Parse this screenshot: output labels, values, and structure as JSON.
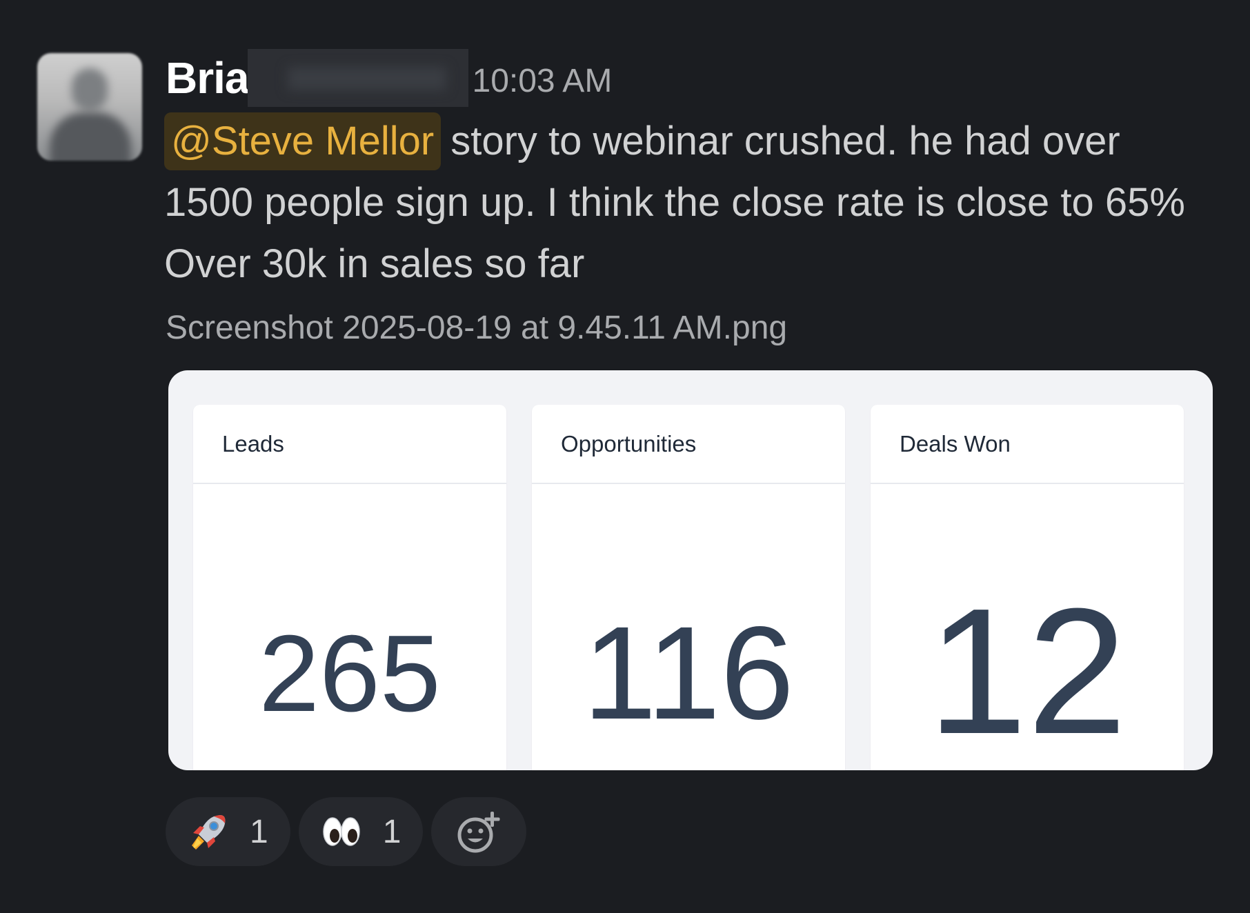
{
  "message": {
    "author_visible": "Bria",
    "timestamp": "10:03 AM",
    "mention": "@Steve Mellor",
    "body": "story to webinar crushed. he had over 1500 people sign up. I think the close rate is close to 65% Over 30k in sales so far",
    "attachment_filename": "Screenshot 2025-08-19 at 9.45.11 AM.png"
  },
  "attachment": {
    "cards": [
      {
        "label": "Leads",
        "value": "265"
      },
      {
        "label": "Opportunities",
        "value": "116"
      },
      {
        "label": "Deals Won",
        "value": "12"
      }
    ]
  },
  "reactions": [
    {
      "icon": "rocket-icon",
      "count": "1"
    },
    {
      "icon": "eyes-icon",
      "count": "1"
    }
  ],
  "colors": {
    "background": "#1b1d21",
    "mention_text": "#e8b13f",
    "mention_bg": "#3e3319",
    "metric_value": "#334155"
  }
}
